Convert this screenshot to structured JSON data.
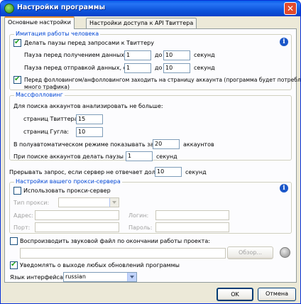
{
  "window": {
    "title": "Настройки программы",
    "close_glyph": "✕"
  },
  "tabs": [
    {
      "label": "Основные настройки",
      "active": true
    },
    {
      "label": "Настройки доступа к API Твиттера",
      "active": false
    }
  ],
  "human": {
    "legend": "Имитация работы человека",
    "pause_checkbox": "Делать паузы перед запросами к Твиттеру",
    "pause_get_label": "Пауза перед получением данных, от:",
    "pause_get_from": "1",
    "pause_get_to": "10",
    "pause_send_label": "Пауза перед отправкой данных, от:",
    "pause_send_from": "1",
    "pause_send_to": "10",
    "to_label": "до",
    "unit": "секунд",
    "follow_checkbox_line1": "Перед фолловингом/анфолловингом заходить на страницу аккаунта (программа будет потреблять",
    "follow_checkbox_line2": "много трафика)"
  },
  "massfollow": {
    "legend": "Массфолловинг",
    "search_label": "Для поиска аккаунтов анализировать не больше:",
    "twitter_pages_label": "страниц Твиттера:",
    "twitter_pages": "15",
    "google_pages_label": "страниц Гугла:",
    "google_pages": "10",
    "semiauto_label": "В полуавтоматическом режиме показывать за раз:",
    "semiauto_value": "20",
    "semiauto_unit": "аккаунтов",
    "pause_search_label": "При поиске аккаунтов делать паузы до:",
    "pause_search_value": "1",
    "pause_search_unit": "секунд"
  },
  "timeout": {
    "label": "Прерывать запрос, если сервер не отвечает дольше:",
    "value": "10",
    "unit": "секунд"
  },
  "proxy": {
    "legend": "Настройки вашего прокси-сервера",
    "use_label": "Использовать прокси-сервер",
    "type_label": "Тип прокси:",
    "address_label": "Адрес:",
    "login_label": "Логин:",
    "port_label": "Порт:",
    "password_label": "Пароль:"
  },
  "sound": {
    "checkbox_label": "Воспроизводить звуковой файл по окончании работы проекта:",
    "path": "",
    "browse_label": "Обзор..."
  },
  "updates": {
    "checkbox_label": "Уведомлять о выходе любых обновлений программы"
  },
  "language": {
    "label": "Язык интерфейса:",
    "value": "russian"
  },
  "buttons": {
    "ok": "OK",
    "cancel": "Отмена"
  },
  "icons": {
    "info": "i",
    "title": "app-globe-icon",
    "play": "play-sound-icon"
  }
}
